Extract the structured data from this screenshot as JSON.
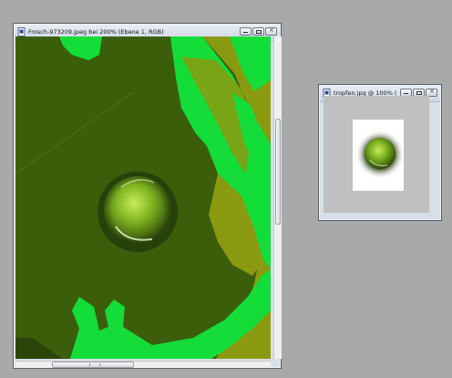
{
  "main_window": {
    "title": "Frosch-973209.jpeg bei 200% (Ebene 1, RGB)",
    "icon": "document-icon",
    "buttons": [
      "minimize-icon",
      "maximize-icon",
      "close-icon"
    ]
  },
  "thumb_window": {
    "title": "tropfen.jpg @ 100% (R...",
    "icon": "document-icon",
    "buttons": [
      "minimize-icon",
      "maximize-icon",
      "close-icon"
    ]
  },
  "colors": {
    "desktop": "#a9a9a9",
    "dark_green": "#3b5e0b",
    "bright_green": "#14dd3a",
    "olive": "#8a9a10"
  }
}
